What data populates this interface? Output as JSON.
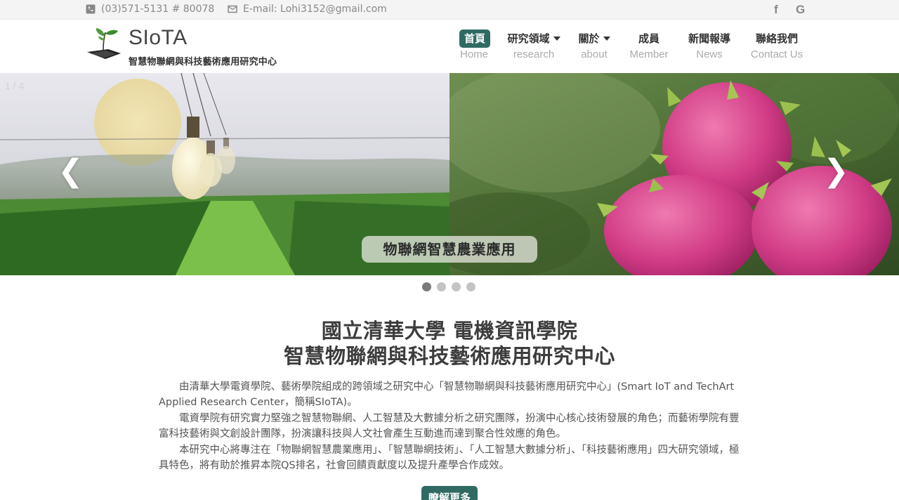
{
  "topbar": {
    "phone": "(03)571-5131 # 80078",
    "email": "E-mail: Lohi3152@gmail.com",
    "social": [
      {
        "icon": "facebook-icon",
        "glyph": "f"
      },
      {
        "icon": "google-icon",
        "glyph": "G"
      }
    ]
  },
  "header": {
    "logo_title": "SIoTA",
    "logo_subtitle": "智慧物聯網與科技藝術應用研究中心"
  },
  "nav": [
    {
      "zh": "首頁",
      "en": "Home",
      "active": true,
      "dropdown": false
    },
    {
      "zh": "研究領域",
      "en": "research",
      "active": false,
      "dropdown": true
    },
    {
      "zh": "關於",
      "en": "about",
      "active": false,
      "dropdown": true
    },
    {
      "zh": "成員",
      "en": "Member",
      "active": false,
      "dropdown": false
    },
    {
      "zh": "新聞報導",
      "en": "News",
      "active": false,
      "dropdown": false
    },
    {
      "zh": "聯絡我們",
      "en": "Contact Us",
      "active": false,
      "dropdown": false
    }
  ],
  "slider": {
    "counter": "1 / 4",
    "caption": "物聯網智慧農業應用",
    "prev_glyph": "❮",
    "next_glyph": "❯",
    "total_slides": 4,
    "active_slide": 1
  },
  "intro": {
    "title_line1": "國立清華大學 電機資訊學院",
    "title_line2": "智慧物聯網與科技藝術應用研究中心",
    "paragraphs": [
      "由清華大學電資學院、藝術學院組成的跨領域之研究中心「智慧物聯網與科技藝術應用研究中心」(Smart IoT and TechArt Applied Research Center，簡稱SIoTA)。",
      "電資學院有研究實力堅強之智慧物聯網、人工智慧及大數據分析之研究團隊，扮演中心核心技術發展的角色；而藝術學院有豐富科技藝術與文創設計團隊，扮演讓科技與人文社會產生互動進而達到聚合性效應的角色。",
      "本研究中心將專注在「物聯網智慧農業應用」、「智慧聯網技術」、「人工智慧大數據分析」、「科技藝術應用」四大研究領域，極具特色，將有助於推昇本院QS排名，社會回饋貢獻度以及提升產學合作成效。"
    ],
    "more_button": "瞭解更多"
  },
  "colors": {
    "accent": "#2f6b63",
    "text": "#555555",
    "muted": "#aaaaaa"
  }
}
